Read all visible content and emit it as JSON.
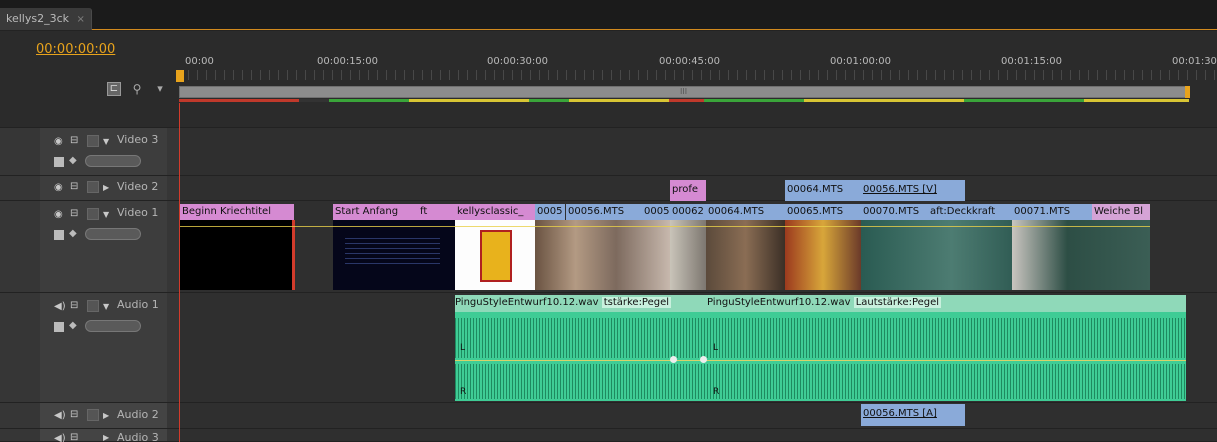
{
  "sequence_tab": {
    "name": "kellys2_3ck",
    "close": "×"
  },
  "timecode": "00:00:00:00",
  "ruler": {
    "labels": [
      "00:00",
      "00:00:15:00",
      "00:00:30:00",
      "00:00:45:00",
      "00:01:00:00",
      "00:01:15:00",
      "00:01:30"
    ]
  },
  "scroll_grip": "III",
  "tracks": {
    "video3": {
      "name": "Video 3"
    },
    "video2": {
      "name": "Video 2"
    },
    "video1": {
      "name": "Video 1"
    },
    "audio1": {
      "name": "Audio 1"
    },
    "audio2": {
      "name": "Audio 2"
    },
    "audio3": {
      "name": "Audio 3"
    }
  },
  "clips": {
    "video2": [
      "profe",
      "00064.MTS",
      "00056.MTS [V]"
    ],
    "video1": [
      "Beginn Kriechtitel",
      "Start Anfang",
      "ft",
      "kellysclassic_",
      "0005",
      "00056.MTS",
      "0005",
      "00062",
      "00064.MTS",
      "00065.MTS",
      "00070.MTS",
      "aft:Deckkraft",
      "00071.MTS",
      "Weiche Bl"
    ],
    "audio1": [
      "PinguStyleEntwurf10.12.wav",
      "tstärke:Pegel",
      "PinguStyleEntwurf10.12.wav",
      "Lautstärke:Pegel"
    ],
    "audio1_channels": [
      "L",
      "R",
      "L",
      "R"
    ],
    "audio2": [
      "00056.MTS [A]"
    ]
  },
  "colors": {
    "accent": "#e8a31c",
    "video_clip": "#8aaad9",
    "title_clip": "#d58ad2",
    "audio_clip": "#3fcc95",
    "playhead": "#d23b2b"
  }
}
